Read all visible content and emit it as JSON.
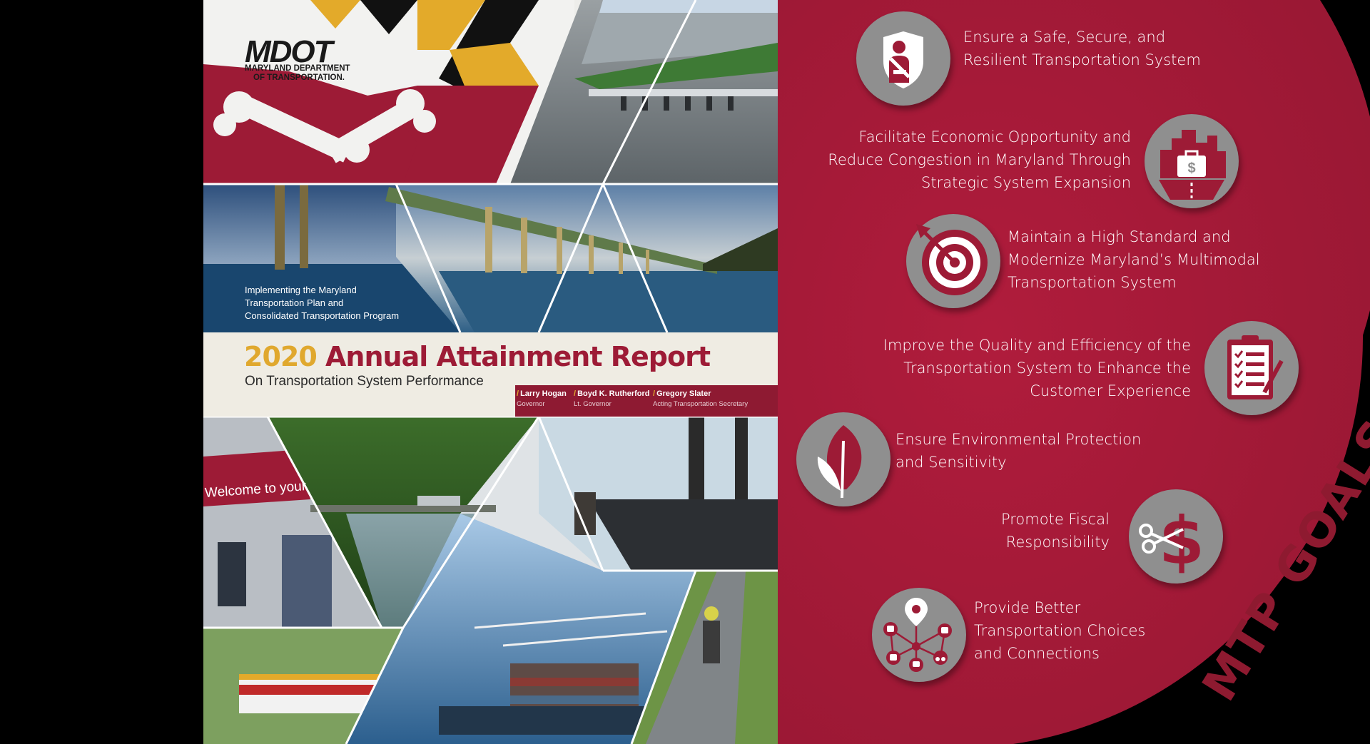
{
  "cover": {
    "logo_text": "MDOT",
    "logo_line1": "MARYLAND DEPARTMENT",
    "logo_line2": "OF TRANSPORTATION.",
    "intro_line1": "Implementing the Maryland",
    "intro_line2": "Transportation Plan and",
    "intro_line3": "Consolidated Transportation Program",
    "title_year": "2020",
    "title_rest": "Annual Attainment Report",
    "subtitle": "On Transportation System Performance",
    "officials": [
      {
        "name": "Larry Hogan",
        "role": "Governor"
      },
      {
        "name": "Boyd K. Rutherford",
        "role": "Lt. Governor"
      },
      {
        "name": "Gregory Slater",
        "role": "Acting Transportation Secretary"
      }
    ],
    "photo_text": "Welcome to your"
  },
  "goals": {
    "heading": "MTP GOALS",
    "items": [
      {
        "lines": [
          "Ensure a Safe, Secure, and",
          "Resilient Transportation System"
        ],
        "icon": "seatbelt-shield-icon"
      },
      {
        "lines": [
          "Facilitate Economic Opportunity and",
          "Reduce Congestion in Maryland Through",
          "Strategic System Expansion"
        ],
        "icon": "city-briefcase-icon"
      },
      {
        "lines": [
          "Maintain a High Standard and",
          "Modernize Maryland’s Multimodal",
          "Transportation System"
        ],
        "icon": "target-icon"
      },
      {
        "lines": [
          "Improve the Quality and Efficiency of the",
          "Transportation System to Enhance the",
          "Customer Experience"
        ],
        "icon": "checklist-icon"
      },
      {
        "lines": [
          "Ensure Environmental Protection",
          "and Sensitivity"
        ],
        "icon": "leaf-icon"
      },
      {
        "lines": [
          "Promote Fiscal",
          "Responsibility"
        ],
        "icon": "dollar-scissors-icon"
      },
      {
        "lines": [
          "Provide Better",
          "Transportation Choices",
          "and Connections"
        ],
        "icon": "multimodal-network-icon"
      }
    ]
  },
  "colors": {
    "maroon": "#9d1b36",
    "gold": "#e0a82e",
    "gray": "#8f8f8f"
  }
}
